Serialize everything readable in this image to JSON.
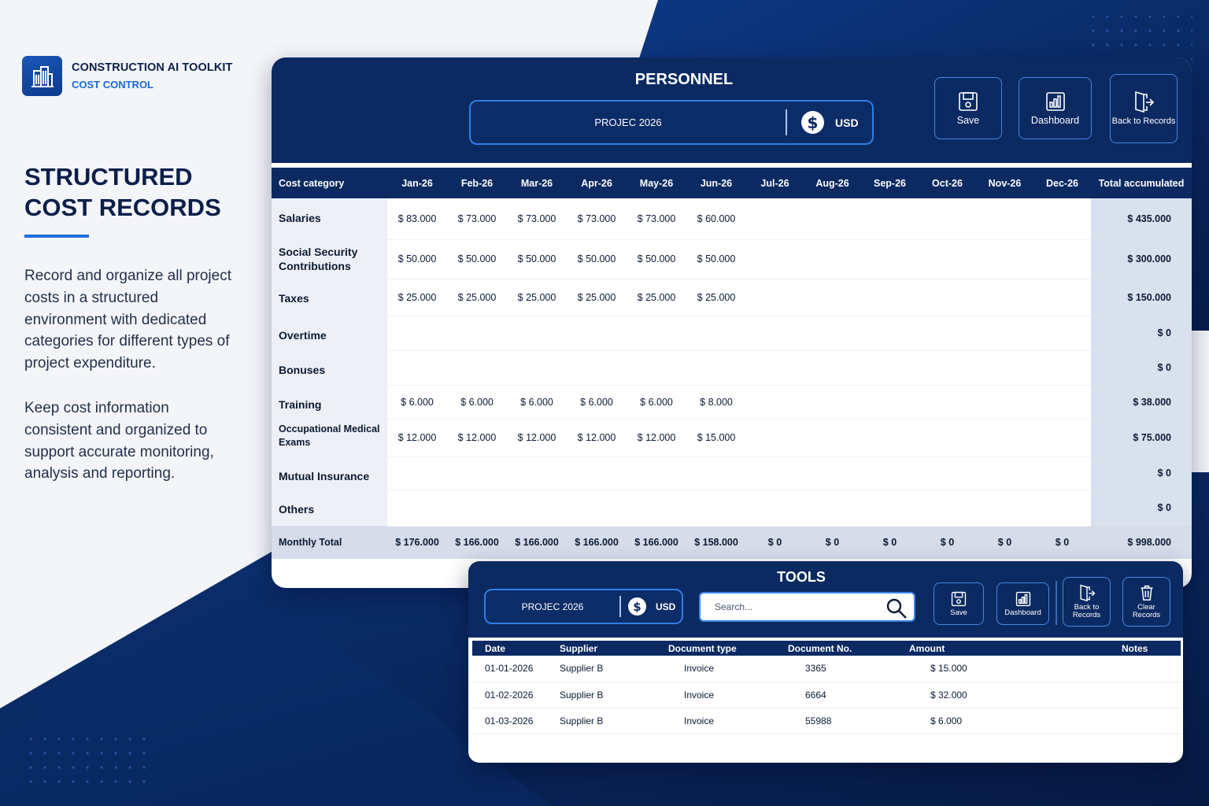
{
  "brand": {
    "title": "CONSTRUCTION AI TOOLKIT",
    "subtitle": "COST CONTROL",
    "icon": "building-icon"
  },
  "hero": {
    "line1": "STRUCTURED",
    "line2": "COST RECORDS"
  },
  "description": {
    "paragraph1": "Record and organize all project costs in a structured environment with dedicated categories for different types of project expenditure.",
    "paragraph2": "Keep cost information consistent and organized to support accurate monitoring, analysis and reporting."
  },
  "colors": {
    "navy": "#0b2a62",
    "accent": "#1f6fde",
    "total_column": "#d9e0ee"
  },
  "personnel": {
    "title": "PERSONNEL",
    "project": "PROJEC 2026",
    "currency": "USD",
    "currency_icon": "dollar-icon",
    "buttons": {
      "save": "Save",
      "dashboard": "Dashboard",
      "back": "Back to Records"
    },
    "table": {
      "headers": [
        "Cost category",
        "Jan-26",
        "Feb-26",
        "Mar-26",
        "Apr-26",
        "May-26",
        "Jun-26",
        "Jul-26",
        "Aug-26",
        "Sep-26",
        "Oct-26",
        "Nov-26",
        "Dec-26",
        "Total accumulated"
      ],
      "rows": [
        {
          "category": "Salaries",
          "values": [
            "$ 83.000",
            "$ 73.000",
            "$ 73.000",
            "$ 73.000",
            "$ 73.000",
            "$ 60.000",
            "",
            "",
            "",
            "",
            "",
            ""
          ],
          "total": "$ 435.000"
        },
        {
          "category": "Social Security Contributions",
          "values": [
            "$ 50.000",
            "$ 50.000",
            "$ 50.000",
            "$ 50.000",
            "$ 50.000",
            "$ 50.000",
            "",
            "",
            "",
            "",
            "",
            ""
          ],
          "total": "$ 300.000"
        },
        {
          "category": "Taxes",
          "values": [
            "$ 25.000",
            "$ 25.000",
            "$ 25.000",
            "$ 25.000",
            "$ 25.000",
            "$ 25.000",
            "",
            "",
            "",
            "",
            "",
            ""
          ],
          "total": "$ 150.000"
        },
        {
          "category": "Overtime",
          "values": [
            "",
            "",
            "",
            "",
            "",
            "",
            "",
            "",
            "",
            "",
            "",
            ""
          ],
          "total": "$ 0"
        },
        {
          "category": "Bonuses",
          "values": [
            "",
            "",
            "",
            "",
            "",
            "",
            "",
            "",
            "",
            "",
            "",
            ""
          ],
          "total": "$ 0"
        },
        {
          "category": "Training",
          "values": [
            "$ 6.000",
            "$ 6.000",
            "$ 6.000",
            "$ 6.000",
            "$ 6.000",
            "$ 8.000",
            "",
            "",
            "",
            "",
            "",
            ""
          ],
          "total": "$ 38.000"
        },
        {
          "category": "Occupational Medical Exams",
          "values": [
            "$ 12.000",
            "$ 12.000",
            "$ 12.000",
            "$ 12.000",
            "$ 12.000",
            "$ 15.000",
            "",
            "",
            "",
            "",
            "",
            ""
          ],
          "total": "$ 75.000"
        },
        {
          "category": "Mutual Insurance",
          "values": [
            "",
            "",
            "",
            "",
            "",
            "",
            "",
            "",
            "",
            "",
            "",
            ""
          ],
          "total": "$ 0"
        },
        {
          "category": "Others",
          "values": [
            "",
            "",
            "",
            "",
            "",
            "",
            "",
            "",
            "",
            "",
            "",
            ""
          ],
          "total": "$ 0"
        }
      ],
      "monthly_total": {
        "label": "Monthly Total",
        "values": [
          "$ 176.000",
          "$ 166.000",
          "$ 166.000",
          "$ 166.000",
          "$ 166.000",
          "$ 158.000",
          "$ 0",
          "$ 0",
          "$ 0",
          "$ 0",
          "$ 0",
          "$ 0"
        ],
        "total": "$ 998.000"
      }
    }
  },
  "tools": {
    "title": "TOOLS",
    "project": "PROJEC 2026",
    "currency": "USD",
    "search_placeholder": "Search...",
    "buttons": {
      "save": "Save",
      "dashboard": "Dashboard",
      "back": "Back to Records",
      "clear": "Clear Records"
    },
    "table": {
      "headers": [
        "Date",
        "Supplier",
        "Document type",
        "Document No.",
        "Amount",
        "Notes"
      ],
      "rows": [
        {
          "date": "01-01-2026",
          "supplier": "Supplier B",
          "doc_type": "Invoice",
          "doc_no": "3365",
          "amount": "$ 15.000",
          "notes": ""
        },
        {
          "date": "01-02-2026",
          "supplier": "Supplier B",
          "doc_type": "Invoice",
          "doc_no": "6664",
          "amount": "$ 32.000",
          "notes": ""
        },
        {
          "date": "01-03-2026",
          "supplier": "Supplier B",
          "doc_type": "Invoice",
          "doc_no": "55988",
          "amount": "$ 6.000",
          "notes": ""
        }
      ]
    }
  }
}
